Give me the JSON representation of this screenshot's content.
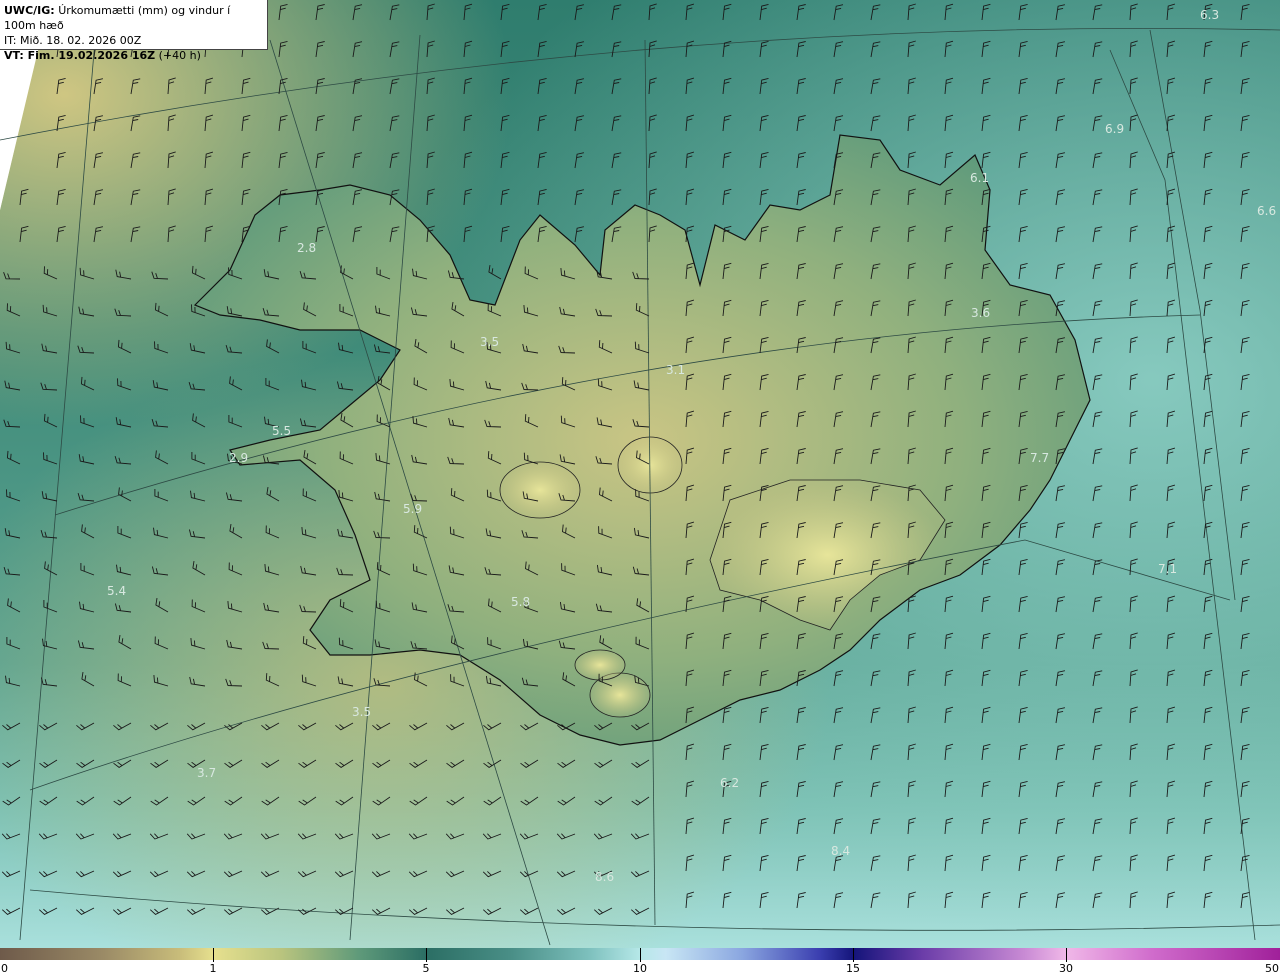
{
  "title": {
    "prefix": "UWC/IG:",
    "description": "Úrkomumætti (mm) og vindur í 100m hæð",
    "init_time": "IT: Mið. 18. 02. 2026 00Z",
    "valid_prefix": "VT: Fim. 19.02.2026 16Z",
    "valid_suffix": "(+40 h)"
  },
  "colorbar": {
    "unit": "mm",
    "ticks": [
      "0",
      "1",
      "5",
      "10",
      "15",
      "30",
      "50"
    ]
  },
  "map_labels": [
    {
      "text": "2.8",
      "area": "Vestfirðir"
    },
    {
      "text": "3.5",
      "area": "Húnaflói"
    },
    {
      "text": "3.1",
      "area": "Norðurland"
    },
    {
      "text": "3.6",
      "area": "Austurland norður"
    },
    {
      "text": "5.5",
      "area": "Breiðafjörður"
    },
    {
      "text": "2.9",
      "area": "Snæfellsnes"
    },
    {
      "text": "5.9",
      "area": "Faxaflói"
    },
    {
      "text": "5.4",
      "area": "Vestan við land"
    },
    {
      "text": "5.8",
      "area": "Suðvesturland"
    },
    {
      "text": "3.5",
      "area": "Sunnan við Reykjanes"
    },
    {
      "text": "3.7",
      "area": "Suðvestan við land"
    },
    {
      "text": "6.2",
      "area": "Sunnan við land"
    },
    {
      "text": "8.4",
      "area": "Suðurhaf"
    },
    {
      "text": "8.6",
      "area": "Suðurhaf vestur"
    },
    {
      "text": "7.1",
      "area": "Suðaustan við land"
    },
    {
      "text": "7.7",
      "area": "Austfirðir"
    },
    {
      "text": "6.1",
      "area": "Norðaustan við land"
    },
    {
      "text": "6.6",
      "area": "Austan við land"
    },
    {
      "text": "6.3",
      "area": "Norðaustur horn"
    },
    {
      "text": "6.9",
      "area": "Norðaustan"
    }
  ],
  "colors": {
    "low": "#c8bc7a",
    "mid": "#2b6e64",
    "high": "#b6e8e8",
    "coast": "#111111"
  }
}
